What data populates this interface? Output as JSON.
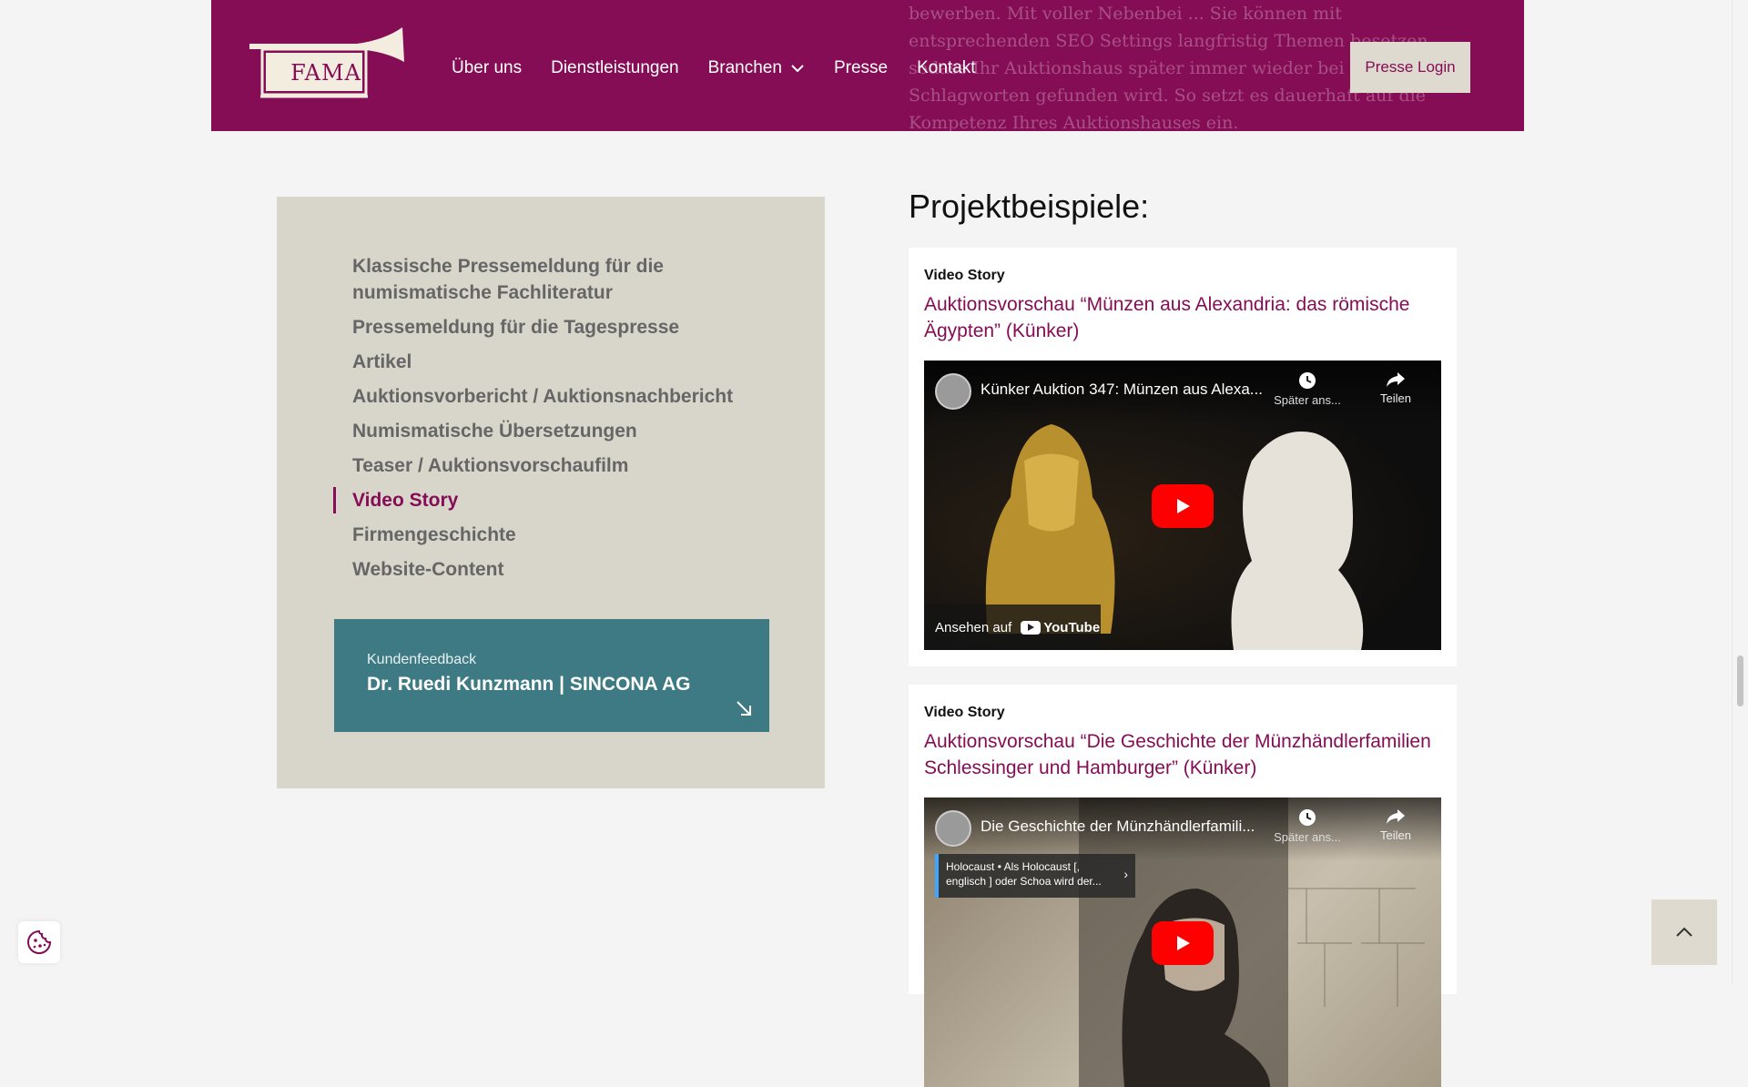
{
  "header": {
    "logo_text": "FAMA",
    "ghost_text": "bewerben. Mit voller Nebenbei ... Sie können mit entsprechenden SEO Settings langfristig Themen besetzen, sodass Ihr Auktionshaus später immer wieder bei bestimmten Schlagworten gefunden wird. So setzt es dauerhaft auf die Kompetenz Ihres Auktionshauses ein.",
    "nav": [
      {
        "label": "Über uns"
      },
      {
        "label": "Dienstleistungen"
      },
      {
        "label": "Branchen"
      },
      {
        "label": "Presse"
      },
      {
        "label": "Kontakt"
      }
    ],
    "login_label": "Presse Login"
  },
  "sidebar": {
    "items": [
      {
        "label": "Klassische Pressemeldung für die numismatische Fachliteratur"
      },
      {
        "label": "Pressemeldung für die Tagespresse"
      },
      {
        "label": "Artikel"
      },
      {
        "label": "Auktionsvorbericht / Auktionsnachbericht"
      },
      {
        "label": "Numismatische Übersetzungen"
      },
      {
        "label": "Teaser / Auktionsvorschaufilm"
      },
      {
        "label": "Video Story"
      },
      {
        "label": "Firmengeschichte"
      },
      {
        "label": "Website-Content"
      }
    ],
    "active_index": 6,
    "feedback": {
      "label": "Kundenfeedback",
      "name": "Dr. Ruedi Kunzmann | SINCONA AG"
    }
  },
  "main": {
    "title": "Projektbeispiele:",
    "cards": [
      {
        "kicker": "Video Story",
        "title": "Auktionsvorschau “Münzen aus Alexandria: das römische Ägypten” (Künker)",
        "video": {
          "title": "Künker Auktion 347: Münzen aus Alexa...",
          "later_label": "Später ans...",
          "share_label": "Teilen",
          "watch_on": "Ansehen auf",
          "yt_label": "YouTube"
        }
      },
      {
        "kicker": "Video Story",
        "title": "Auktionsvorschau “Die Geschichte der Münzhändlerfamilien Schlessinger und Hamburger” (Künker)",
        "video": {
          "title": "Die Geschichte der Münzhändlerfamili...",
          "later_label": "Später ans...",
          "share_label": "Teilen",
          "info_card": "Holocaust • Als Holocaust [, englisch ] oder Schoa wird der..."
        }
      }
    ]
  },
  "colors": {
    "brand": "#850d55",
    "sidebar_bg": "#d8d6cb",
    "feedback_bg": "#3d7a84",
    "button_bg": "#dedad0"
  }
}
